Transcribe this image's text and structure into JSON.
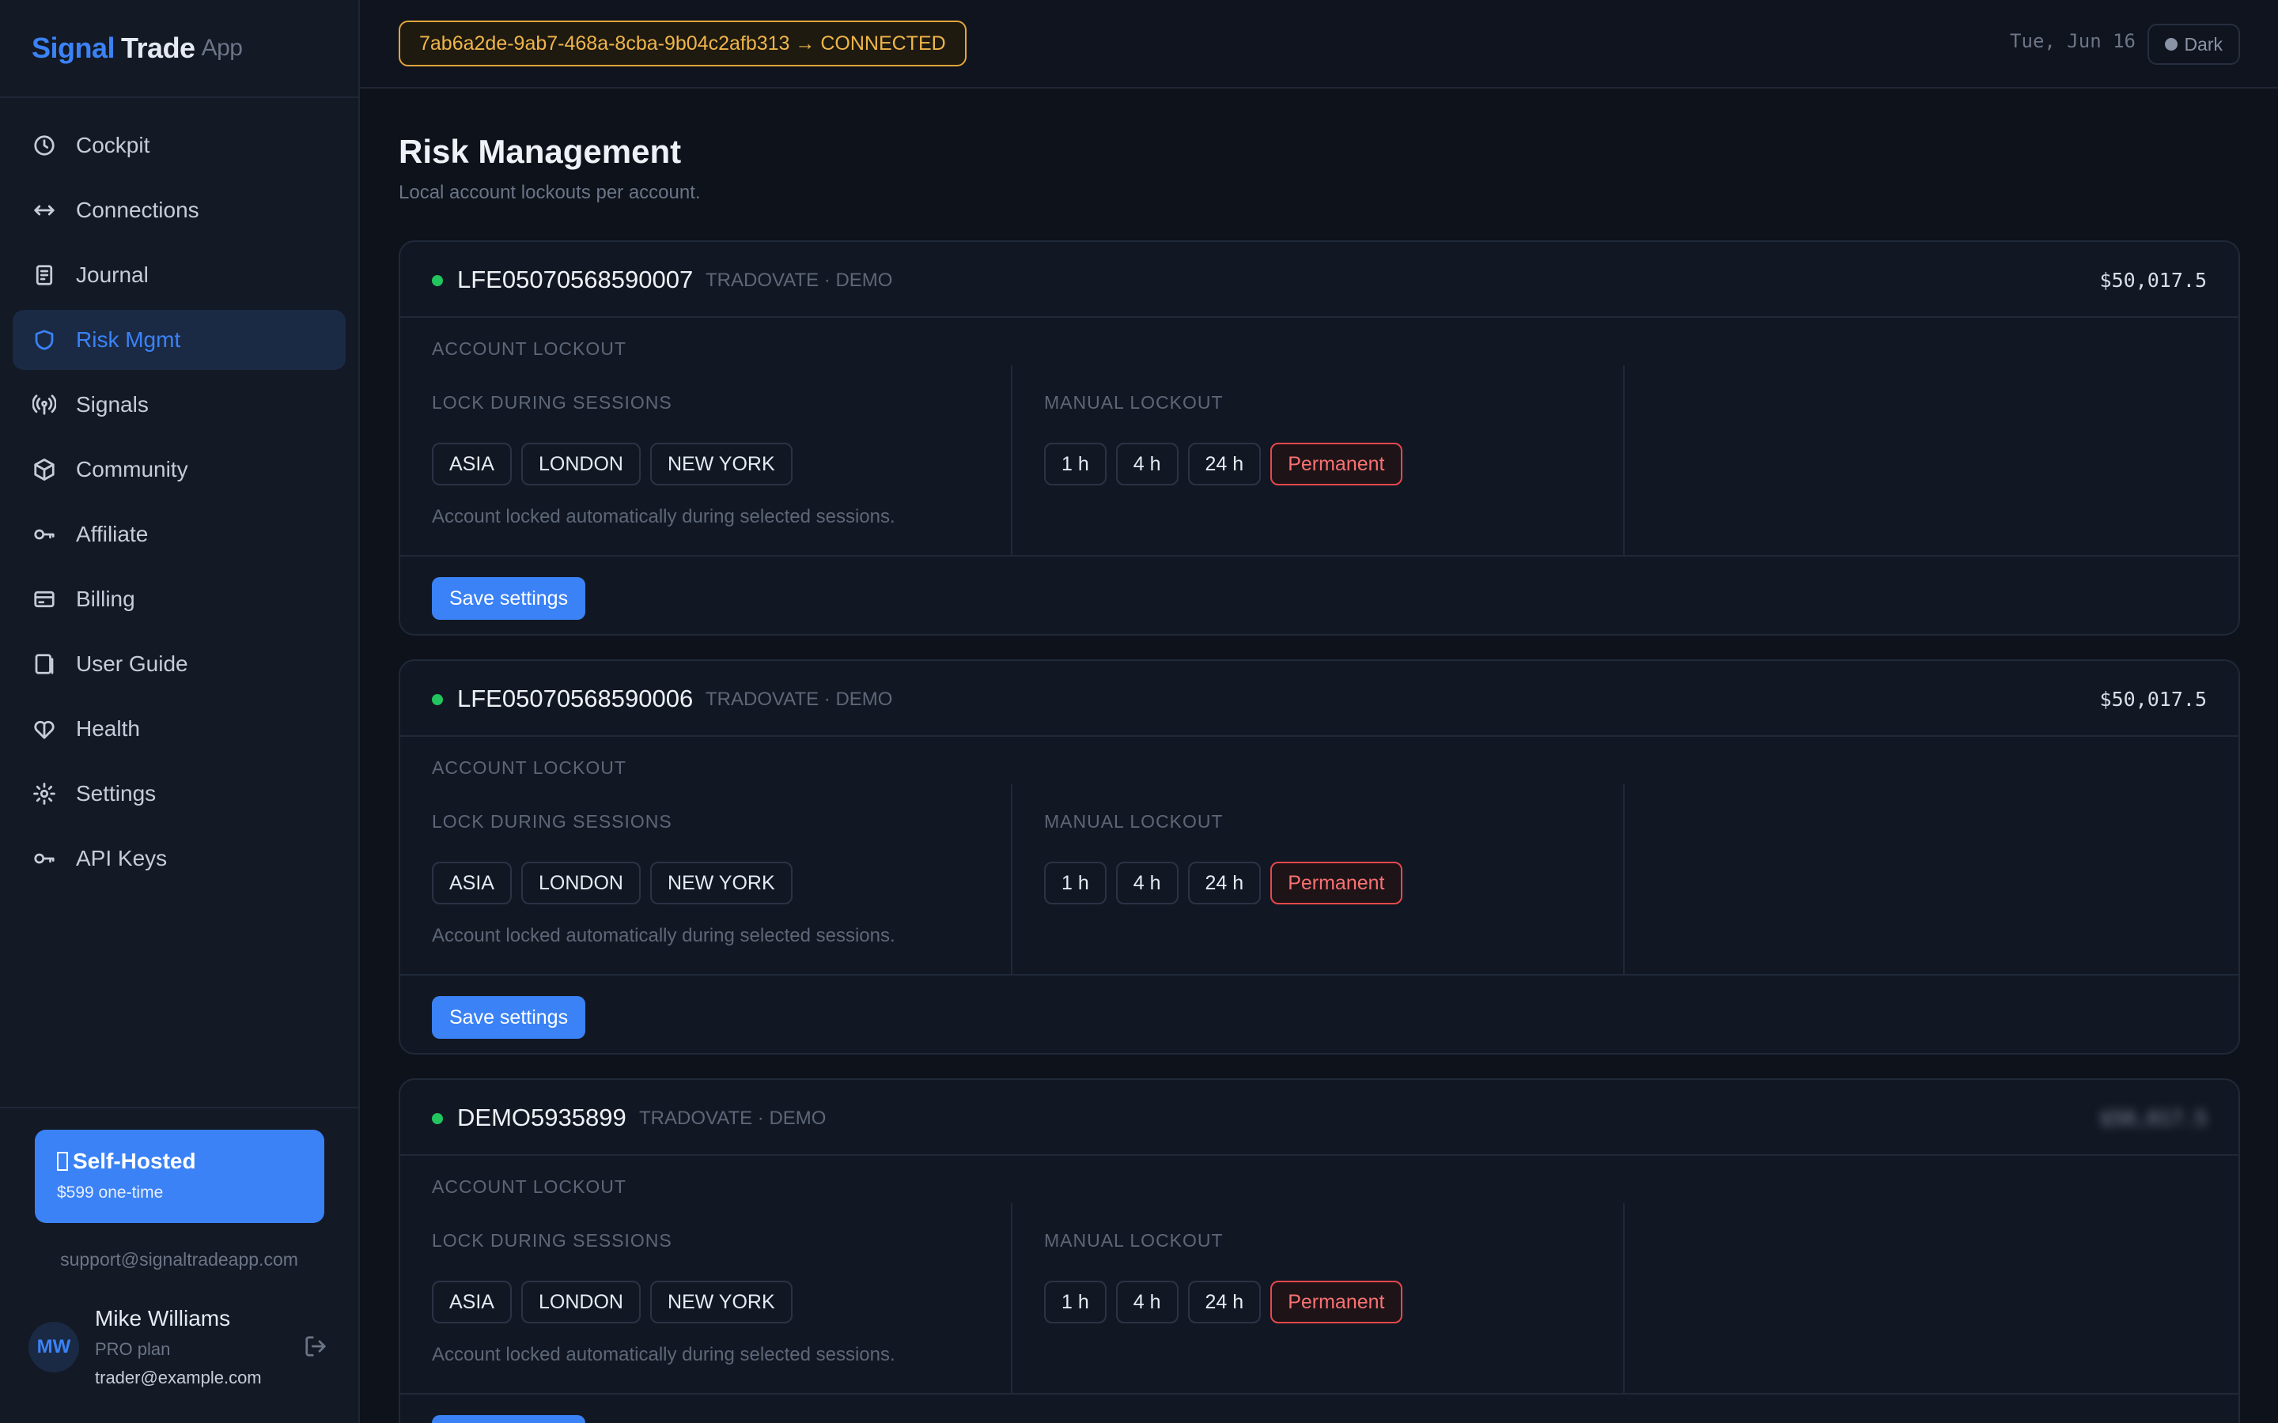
{
  "brand": {
    "part1": "Signal",
    "part2": "Trade",
    "part3": "App"
  },
  "nav": [
    {
      "label": "Cockpit",
      "icon": "clock-icon"
    },
    {
      "label": "Connections",
      "icon": "arrows-icon"
    },
    {
      "label": "Journal",
      "icon": "journal-icon"
    },
    {
      "label": "Risk Mgmt",
      "icon": "shield-icon",
      "active": true
    },
    {
      "label": "Signals",
      "icon": "signal-icon"
    },
    {
      "label": "Community",
      "icon": "cube-icon"
    },
    {
      "label": "Affiliate",
      "icon": "key-icon"
    },
    {
      "label": "Billing",
      "icon": "card-icon"
    },
    {
      "label": "User Guide",
      "icon": "book-icon"
    },
    {
      "label": "Health",
      "icon": "heart-icon"
    },
    {
      "label": "Settings",
      "icon": "gear-icon"
    },
    {
      "label": "API Keys",
      "icon": "key-icon"
    }
  ],
  "promo": {
    "title": "Self-Hosted",
    "price": "$599 one-time"
  },
  "support_email": "support@signaltradeapp.com",
  "user": {
    "initials": "MW",
    "name": "Mike Williams",
    "plan": "PRO plan",
    "email": "trader@example.com"
  },
  "topbar": {
    "connection": "7ab6a2de-9ab7-468a-8cba-9b04c2afb313 → CONNECTED",
    "date": "Tue, Jun 16",
    "theme": "Dark"
  },
  "page": {
    "title": "Risk Management",
    "subtitle": "Local account lockouts per account."
  },
  "labels": {
    "account_lockout": "ACCOUNT LOCKOUT",
    "lock_sessions": "LOCK DURING SESSIONS",
    "manual_lockout": "MANUAL LOCKOUT",
    "sessions_note": "Account locked automatically during selected sessions.",
    "save": "Save settings",
    "sessions": [
      "ASIA",
      "LONDON",
      "NEW YORK"
    ],
    "durations": [
      "1 h",
      "4 h",
      "24 h",
      "Permanent"
    ]
  },
  "accounts": [
    {
      "id": "LFE05070568590007",
      "meta": "TRADOVATE · DEMO",
      "balance": "$50,017.5",
      "blurred": false
    },
    {
      "id": "LFE05070568590006",
      "meta": "TRADOVATE · DEMO",
      "balance": "$50,017.5",
      "blurred": false
    },
    {
      "id": "DEMO5935899",
      "meta": "TRADOVATE · DEMO",
      "balance": "$50,017.5",
      "blurred": true
    }
  ],
  "colors": {
    "accent": "#3b82f6",
    "warning": "#e2a53a",
    "danger": "#e5484d",
    "online": "#22c55e"
  }
}
